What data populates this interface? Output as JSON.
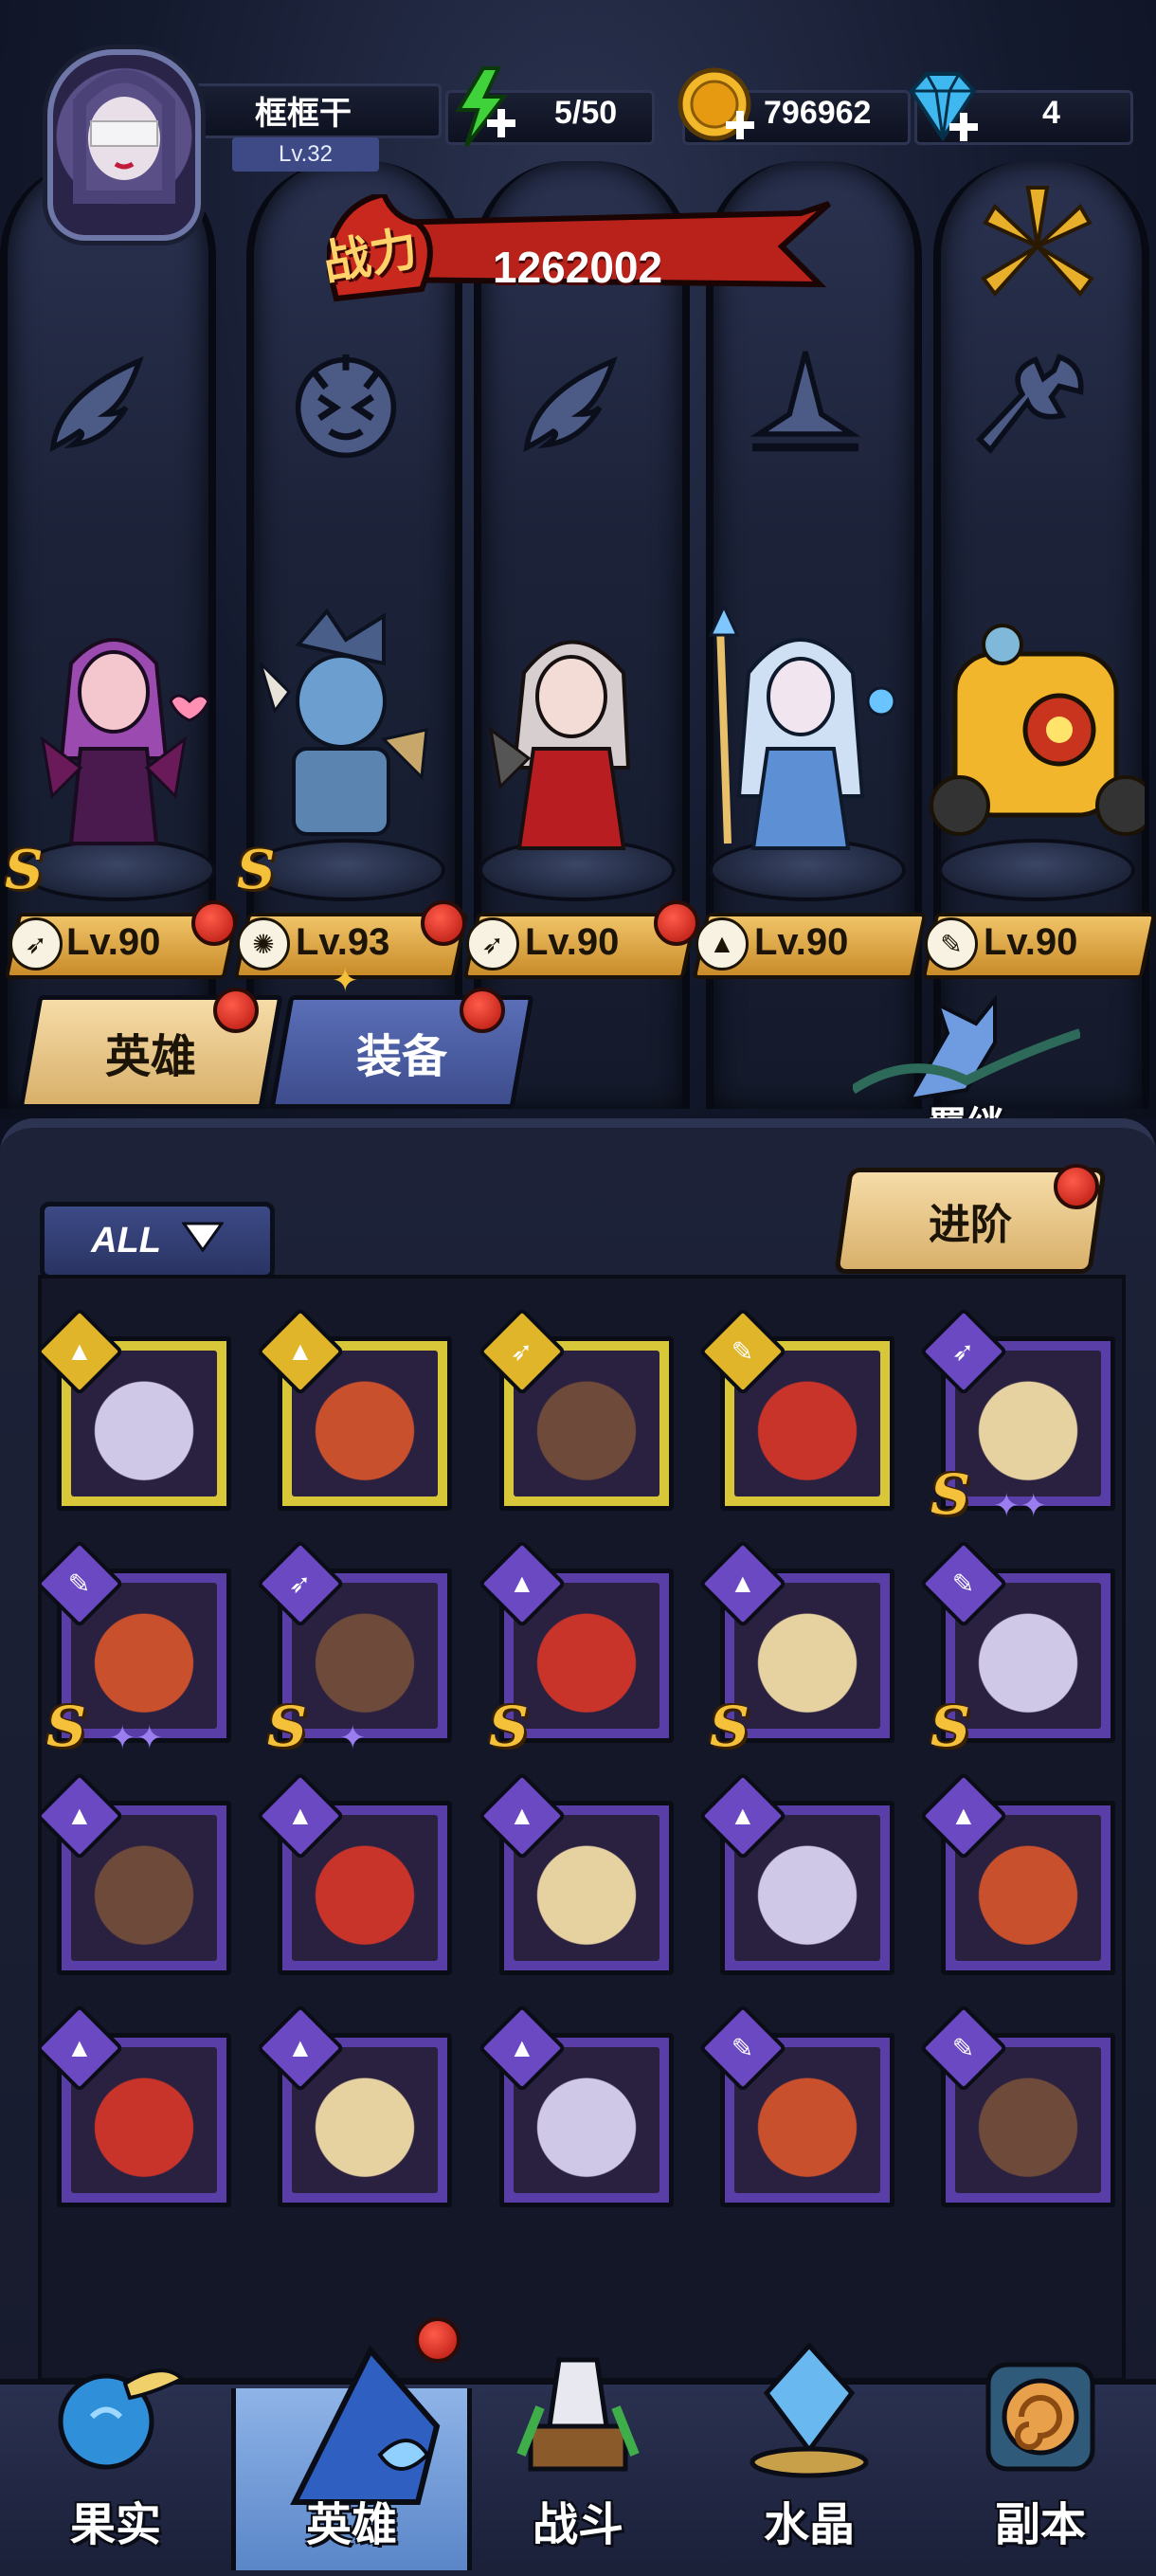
{
  "player": {
    "name": "框框干",
    "level": "Lv.32"
  },
  "resources": {
    "energy": "5/50",
    "gold": "796962",
    "gems": "4"
  },
  "power": {
    "label": "战力",
    "value": "1262002"
  },
  "lineup": [
    {
      "level": "Lv.90",
      "class_icon": "wing-icon",
      "rank": "S",
      "notify": true
    },
    {
      "level": "Lv.93",
      "class_icon": "beast-icon",
      "rank": "S",
      "notify": true
    },
    {
      "level": "Lv.90",
      "class_icon": "wing-icon",
      "rank": "",
      "notify": true
    },
    {
      "level": "Lv.90",
      "class_icon": "hat-icon",
      "rank": "",
      "notify": false
    },
    {
      "level": "Lv.90",
      "class_icon": "wrench-icon",
      "rank": "",
      "notify": false
    }
  ],
  "tabs": {
    "heroes": "英雄",
    "equipment": "装备"
  },
  "bond": {
    "label": "羁绊"
  },
  "filter": {
    "label": "ALL"
  },
  "advance": {
    "label": "进阶"
  },
  "rank_letter": "S",
  "hero_cards": [
    [
      {
        "frame": "gold",
        "icon": "hat-icon"
      },
      {
        "frame": "gold",
        "icon": "hat-icon"
      },
      {
        "frame": "gold",
        "icon": "wing-icon"
      },
      {
        "frame": "gold",
        "icon": "wrench-icon"
      },
      {
        "frame": "purple",
        "icon": "wing-icon",
        "s": true,
        "stars": 2
      }
    ],
    [
      {
        "frame": "purple",
        "icon": "wrench-icon",
        "s": true,
        "stars": 2
      },
      {
        "frame": "purple",
        "icon": "wing-icon",
        "s": true,
        "stars": 1
      },
      {
        "frame": "purple",
        "icon": "hat-icon",
        "s": true
      },
      {
        "frame": "purple",
        "icon": "hat-icon",
        "s": true
      },
      {
        "frame": "purple",
        "icon": "wrench-icon",
        "s": true
      }
    ],
    [
      {
        "frame": "purple",
        "icon": "hat-icon"
      },
      {
        "frame": "purple",
        "icon": "hat-icon"
      },
      {
        "frame": "purple",
        "icon": "hat-icon"
      },
      {
        "frame": "purple",
        "icon": "hat-icon"
      },
      {
        "frame": "purple",
        "icon": "hat-icon"
      }
    ],
    [
      {
        "frame": "purple",
        "icon": "hat-icon"
      },
      {
        "frame": "purple",
        "icon": "hat-icon"
      },
      {
        "frame": "purple",
        "icon": "hat-icon"
      },
      {
        "frame": "purple",
        "icon": "wrench-icon"
      },
      {
        "frame": "purple",
        "icon": "wrench-icon"
      }
    ]
  ],
  "nav": [
    {
      "label": "果实",
      "icon": "fruit-icon",
      "active": false
    },
    {
      "label": "英雄",
      "icon": "wizard-hat-icon",
      "active": true,
      "notify": true
    },
    {
      "label": "战斗",
      "icon": "battle-icon",
      "active": false
    },
    {
      "label": "水晶",
      "icon": "crystal-icon",
      "active": false
    },
    {
      "label": "副本",
      "icon": "dungeon-icon",
      "active": false
    }
  ],
  "colors": {
    "gold": "#d9c73a",
    "purple": "#5a3ea8",
    "accent_red": "#c41d12",
    "level_plate": "#e3ad4c",
    "nav_active": "#6f98d8"
  }
}
